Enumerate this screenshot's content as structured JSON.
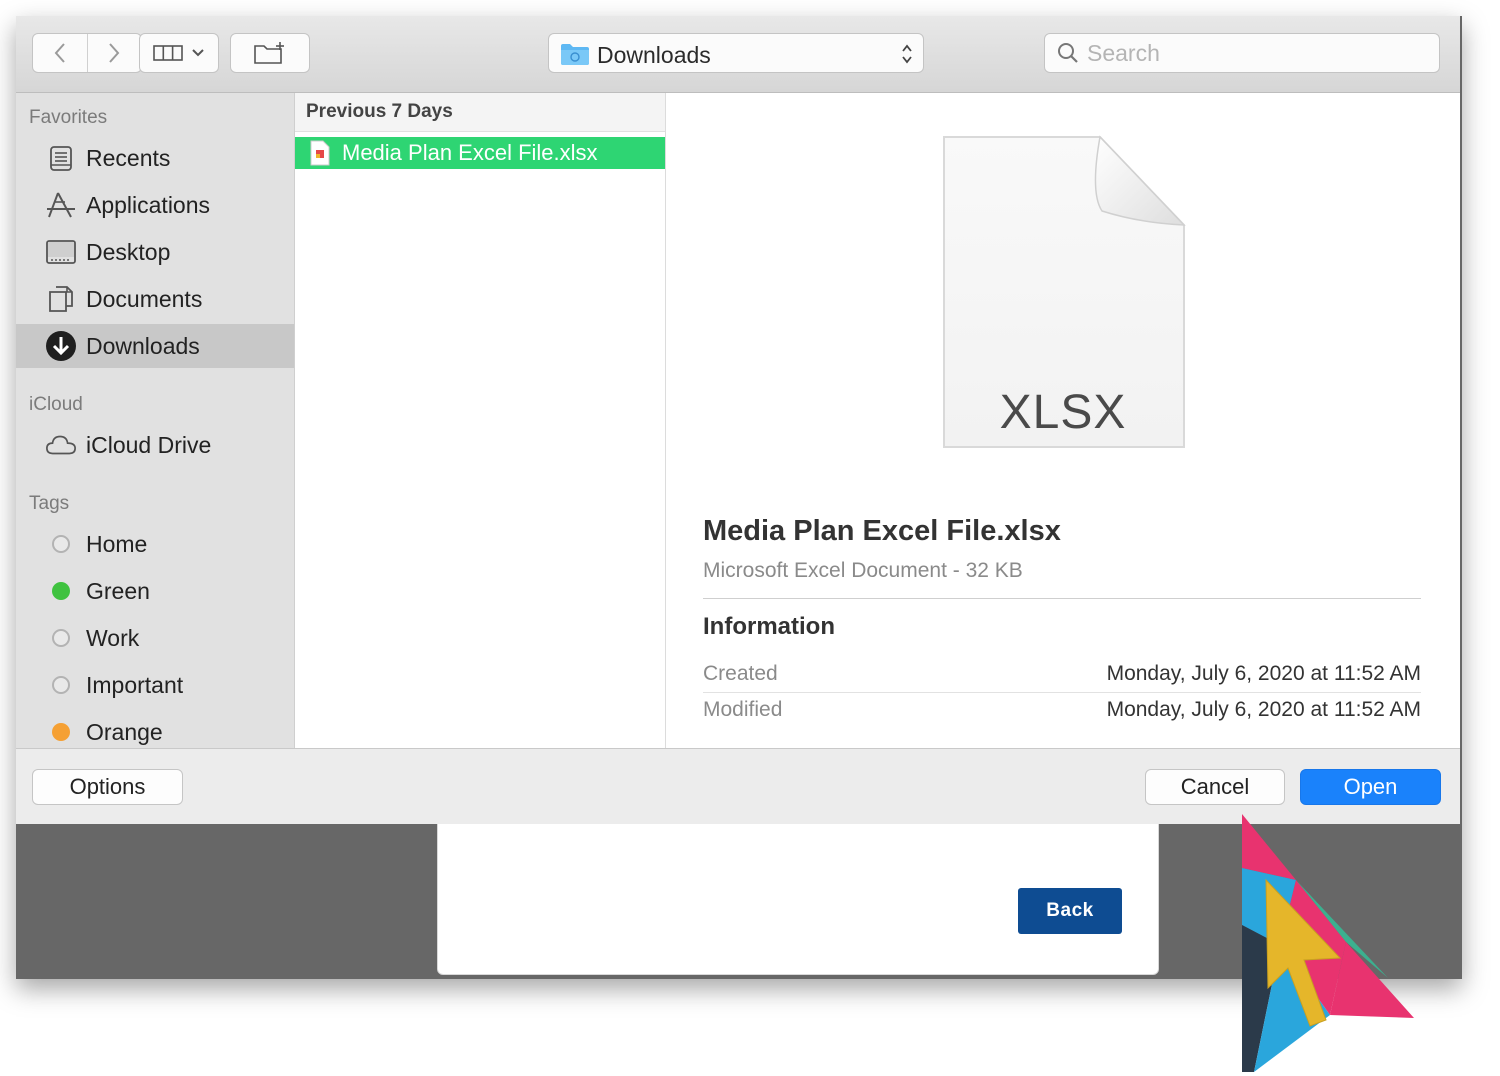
{
  "toolbar": {
    "path_label": "Downloads",
    "search_placeholder": "Search"
  },
  "sidebar": {
    "favorites_heading": "Favorites",
    "favorites": [
      {
        "label": "Recents"
      },
      {
        "label": "Applications"
      },
      {
        "label": "Desktop"
      },
      {
        "label": "Documents"
      },
      {
        "label": "Downloads",
        "selected": true
      }
    ],
    "icloud_heading": "iCloud",
    "icloud": [
      {
        "label": "iCloud Drive"
      }
    ],
    "tags_heading": "Tags",
    "tags": [
      {
        "label": "Home",
        "color": ""
      },
      {
        "label": "Green",
        "color": "#3fc23f"
      },
      {
        "label": "Work",
        "color": ""
      },
      {
        "label": "Important",
        "color": ""
      },
      {
        "label": "Orange",
        "color": "#f5a033"
      }
    ]
  },
  "column": {
    "header": "Previous 7 Days",
    "files": [
      {
        "name": "Media Plan Excel File.xlsx",
        "selected": true
      }
    ]
  },
  "preview": {
    "extension": "XLSX",
    "title": "Media Plan Excel File.xlsx",
    "subtitle": "Microsoft Excel Document - 32 KB",
    "info_heading": "Information",
    "rows": [
      {
        "key": "Created",
        "value": "Monday, July 6, 2020 at 11:52 AM"
      },
      {
        "key": "Modified",
        "value": "Monday, July 6, 2020 at 11:52 AM"
      }
    ]
  },
  "buttons": {
    "options": "Options",
    "cancel": "Cancel",
    "open": "Open"
  },
  "background_page": {
    "back_label": "Back"
  },
  "colors": {
    "selection_green": "#2ed573",
    "open_blue": "#1a82fb",
    "back_blue": "#0e4c92"
  }
}
